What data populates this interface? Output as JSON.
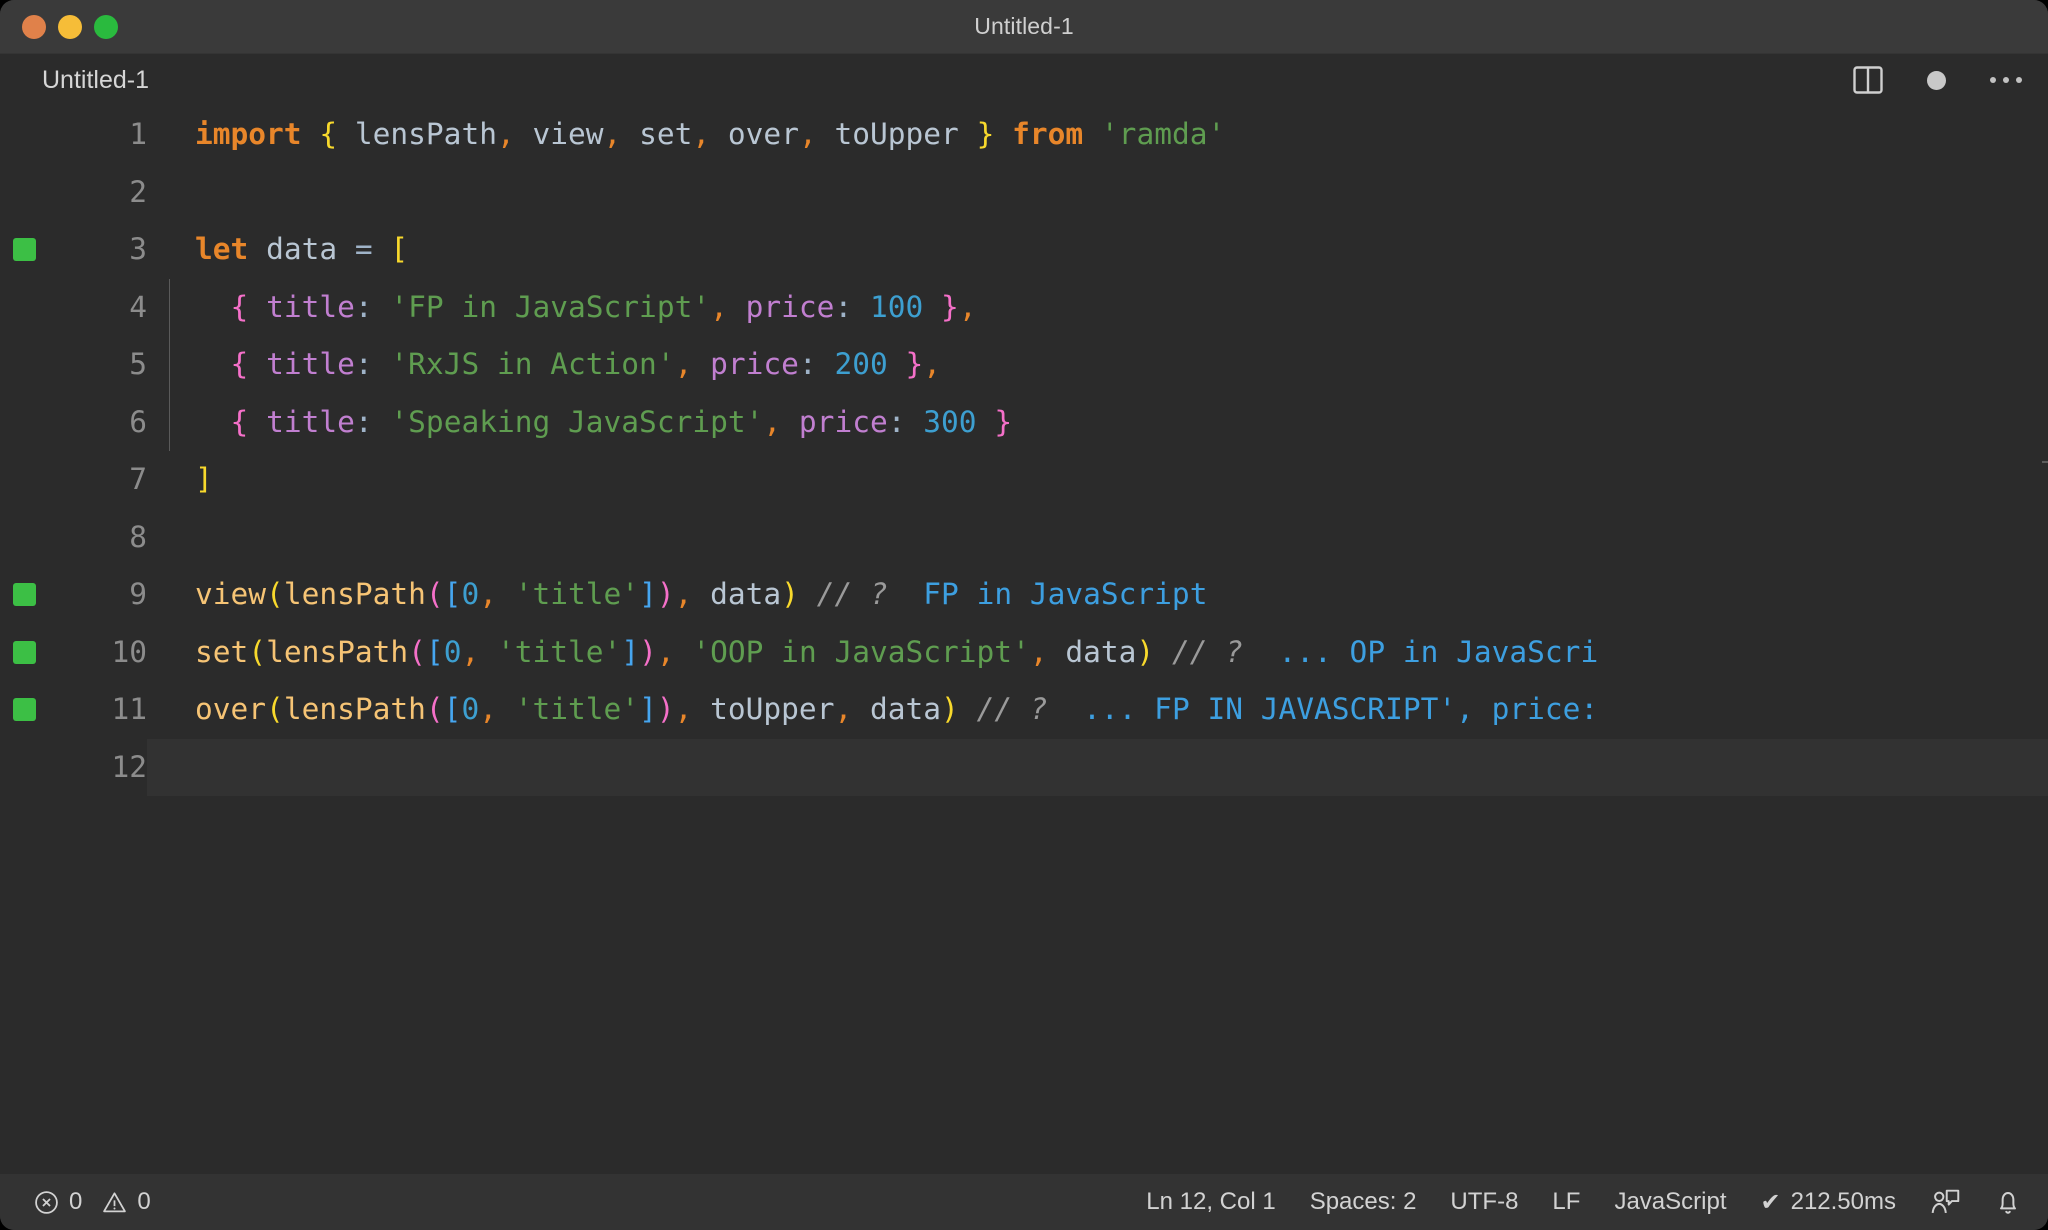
{
  "window": {
    "title": "Untitled-1",
    "traffic_lights": [
      {
        "name": "close",
        "color": "#e0814a"
      },
      {
        "name": "minimize",
        "color": "#f6bd38"
      },
      {
        "name": "maximize",
        "color": "#2aba3e"
      }
    ]
  },
  "tabbar": {
    "tab_label": "Untitled-1",
    "actions": [
      {
        "icon": "split-editor-icon"
      },
      {
        "icon": "unsaved-dot-icon"
      },
      {
        "icon": "more-actions-icon"
      }
    ]
  },
  "editor": {
    "language": "JavaScript",
    "current_line": 12,
    "lines": [
      {
        "n": "1",
        "mark": false,
        "indent": false,
        "current": false,
        "tokens": [
          {
            "t": "import",
            "c": "kw"
          },
          {
            "t": " ",
            "c": "id"
          },
          {
            "t": "{",
            "c": "punc-y"
          },
          {
            "t": " ",
            "c": "id"
          },
          {
            "t": "lensPath",
            "c": "id"
          },
          {
            "t": ",",
            "c": "comma"
          },
          {
            "t": " ",
            "c": "id"
          },
          {
            "t": "view",
            "c": "id"
          },
          {
            "t": ",",
            "c": "comma"
          },
          {
            "t": " ",
            "c": "id"
          },
          {
            "t": "set",
            "c": "id"
          },
          {
            "t": ",",
            "c": "comma"
          },
          {
            "t": " ",
            "c": "id"
          },
          {
            "t": "over",
            "c": "id"
          },
          {
            "t": ",",
            "c": "comma"
          },
          {
            "t": " ",
            "c": "id"
          },
          {
            "t": "toUpper",
            "c": "id"
          },
          {
            "t": " ",
            "c": "id"
          },
          {
            "t": "}",
            "c": "punc-y"
          },
          {
            "t": " ",
            "c": "id"
          },
          {
            "t": "from",
            "c": "kw"
          },
          {
            "t": " ",
            "c": "id"
          },
          {
            "t": "'ramda'",
            "c": "str"
          }
        ]
      },
      {
        "n": "2",
        "mark": false,
        "indent": false,
        "current": false,
        "tokens": []
      },
      {
        "n": "3",
        "mark": true,
        "indent": false,
        "current": false,
        "tokens": [
          {
            "t": "let",
            "c": "kw"
          },
          {
            "t": " ",
            "c": "id"
          },
          {
            "t": "data",
            "c": "id"
          },
          {
            "t": " ",
            "c": "id"
          },
          {
            "t": "=",
            "c": "colon"
          },
          {
            "t": " ",
            "c": "id"
          },
          {
            "t": "[",
            "c": "punc-y"
          }
        ]
      },
      {
        "n": "4",
        "mark": false,
        "indent": true,
        "current": false,
        "tokens": [
          {
            "t": "  ",
            "c": "id"
          },
          {
            "t": "{",
            "c": "punc-p"
          },
          {
            "t": " ",
            "c": "id"
          },
          {
            "t": "title",
            "c": "prop"
          },
          {
            "t": ":",
            "c": "colon"
          },
          {
            "t": " ",
            "c": "id"
          },
          {
            "t": "'FP in JavaScript'",
            "c": "str"
          },
          {
            "t": ",",
            "c": "comma"
          },
          {
            "t": " ",
            "c": "id"
          },
          {
            "t": "price",
            "c": "prop"
          },
          {
            "t": ":",
            "c": "colon"
          },
          {
            "t": " ",
            "c": "id"
          },
          {
            "t": "100",
            "c": "num"
          },
          {
            "t": " ",
            "c": "id"
          },
          {
            "t": "}",
            "c": "punc-p"
          },
          {
            "t": ",",
            "c": "comma"
          }
        ]
      },
      {
        "n": "5",
        "mark": false,
        "indent": true,
        "current": false,
        "tokens": [
          {
            "t": "  ",
            "c": "id"
          },
          {
            "t": "{",
            "c": "punc-p"
          },
          {
            "t": " ",
            "c": "id"
          },
          {
            "t": "title",
            "c": "prop"
          },
          {
            "t": ":",
            "c": "colon"
          },
          {
            "t": " ",
            "c": "id"
          },
          {
            "t": "'RxJS in Action'",
            "c": "str"
          },
          {
            "t": ",",
            "c": "comma"
          },
          {
            "t": " ",
            "c": "id"
          },
          {
            "t": "price",
            "c": "prop"
          },
          {
            "t": ":",
            "c": "colon"
          },
          {
            "t": " ",
            "c": "id"
          },
          {
            "t": "200",
            "c": "num"
          },
          {
            "t": " ",
            "c": "id"
          },
          {
            "t": "}",
            "c": "punc-p"
          },
          {
            "t": ",",
            "c": "comma"
          }
        ]
      },
      {
        "n": "6",
        "mark": false,
        "indent": true,
        "current": false,
        "tokens": [
          {
            "t": "  ",
            "c": "id"
          },
          {
            "t": "{",
            "c": "punc-p"
          },
          {
            "t": " ",
            "c": "id"
          },
          {
            "t": "title",
            "c": "prop"
          },
          {
            "t": ":",
            "c": "colon"
          },
          {
            "t": " ",
            "c": "id"
          },
          {
            "t": "'Speaking JavaScript'",
            "c": "str"
          },
          {
            "t": ",",
            "c": "comma"
          },
          {
            "t": " ",
            "c": "id"
          },
          {
            "t": "price",
            "c": "prop"
          },
          {
            "t": ":",
            "c": "colon"
          },
          {
            "t": " ",
            "c": "id"
          },
          {
            "t": "300",
            "c": "num"
          },
          {
            "t": " ",
            "c": "id"
          },
          {
            "t": "}",
            "c": "punc-p"
          }
        ]
      },
      {
        "n": "7",
        "mark": false,
        "indent": false,
        "current": false,
        "tokens": [
          {
            "t": "]",
            "c": "punc-y"
          }
        ]
      },
      {
        "n": "8",
        "mark": false,
        "indent": false,
        "current": false,
        "tokens": []
      },
      {
        "n": "9",
        "mark": true,
        "indent": false,
        "current": false,
        "tokens": [
          {
            "t": "view",
            "c": "fn"
          },
          {
            "t": "(",
            "c": "punc-y"
          },
          {
            "t": "lensPath",
            "c": "fn"
          },
          {
            "t": "(",
            "c": "punc-p"
          },
          {
            "t": "[",
            "c": "punc-b"
          },
          {
            "t": "0",
            "c": "num"
          },
          {
            "t": ",",
            "c": "comma"
          },
          {
            "t": " ",
            "c": "id"
          },
          {
            "t": "'title'",
            "c": "str"
          },
          {
            "t": "]",
            "c": "punc-b"
          },
          {
            "t": ")",
            "c": "punc-p"
          },
          {
            "t": ",",
            "c": "comma"
          },
          {
            "t": " ",
            "c": "id"
          },
          {
            "t": "data",
            "c": "id"
          },
          {
            "t": ")",
            "c": "punc-y"
          },
          {
            "t": " ",
            "c": "id"
          },
          {
            "t": "// ?",
            "c": "cmt"
          },
          {
            "t": "  ",
            "c": "id"
          },
          {
            "t": "FP in JavaScript",
            "c": "res"
          }
        ]
      },
      {
        "n": "10",
        "mark": true,
        "indent": false,
        "current": false,
        "tokens": [
          {
            "t": "set",
            "c": "fn"
          },
          {
            "t": "(",
            "c": "punc-y"
          },
          {
            "t": "lensPath",
            "c": "fn"
          },
          {
            "t": "(",
            "c": "punc-p"
          },
          {
            "t": "[",
            "c": "punc-b"
          },
          {
            "t": "0",
            "c": "num"
          },
          {
            "t": ",",
            "c": "comma"
          },
          {
            "t": " ",
            "c": "id"
          },
          {
            "t": "'title'",
            "c": "str"
          },
          {
            "t": "]",
            "c": "punc-b"
          },
          {
            "t": ")",
            "c": "punc-p"
          },
          {
            "t": ",",
            "c": "comma"
          },
          {
            "t": " ",
            "c": "id"
          },
          {
            "t": "'OOP in JavaScript'",
            "c": "str"
          },
          {
            "t": ",",
            "c": "comma"
          },
          {
            "t": " ",
            "c": "id"
          },
          {
            "t": "data",
            "c": "id"
          },
          {
            "t": ")",
            "c": "punc-y"
          },
          {
            "t": " ",
            "c": "id"
          },
          {
            "t": "// ?",
            "c": "cmt"
          },
          {
            "t": "  ",
            "c": "id"
          },
          {
            "t": "... OP in JavaScri",
            "c": "res"
          }
        ]
      },
      {
        "n": "11",
        "mark": true,
        "indent": false,
        "current": false,
        "tokens": [
          {
            "t": "over",
            "c": "fn"
          },
          {
            "t": "(",
            "c": "punc-y"
          },
          {
            "t": "lensPath",
            "c": "fn"
          },
          {
            "t": "(",
            "c": "punc-p"
          },
          {
            "t": "[",
            "c": "punc-b"
          },
          {
            "t": "0",
            "c": "num"
          },
          {
            "t": ",",
            "c": "comma"
          },
          {
            "t": " ",
            "c": "id"
          },
          {
            "t": "'title'",
            "c": "str"
          },
          {
            "t": "]",
            "c": "punc-b"
          },
          {
            "t": ")",
            "c": "punc-p"
          },
          {
            "t": ",",
            "c": "comma"
          },
          {
            "t": " ",
            "c": "id"
          },
          {
            "t": "toUpper",
            "c": "id"
          },
          {
            "t": ",",
            "c": "comma"
          },
          {
            "t": " ",
            "c": "id"
          },
          {
            "t": "data",
            "c": "id"
          },
          {
            "t": ")",
            "c": "punc-y"
          },
          {
            "t": " ",
            "c": "id"
          },
          {
            "t": "// ?",
            "c": "cmt"
          },
          {
            "t": "  ",
            "c": "id"
          },
          {
            "t": "... FP IN JAVASCRIPT', price:",
            "c": "res"
          }
        ]
      },
      {
        "n": "12",
        "mark": false,
        "indent": false,
        "current": true,
        "tokens": []
      }
    ]
  },
  "statusbar": {
    "errors": "0",
    "warnings": "0",
    "cursor": "Ln 12, Col 1",
    "indentation": "Spaces: 2",
    "encoding": "UTF-8",
    "eol": "LF",
    "language": "JavaScript",
    "runtime": "212.50ms",
    "runtime_prefix": "✔",
    "icons": [
      "error-icon",
      "warning-icon",
      "feedback-icon",
      "bell-icon"
    ]
  },
  "colors": {
    "editor_background": "#2b2b2b",
    "titlebar_background": "#3a3a3a",
    "statusbar_background": "#333333",
    "gutter_mark": "#3cbf45",
    "keyword": "#e8862a",
    "string": "#5f9d50",
    "number": "#3d9fd0",
    "function": "#f6c475",
    "property": "#c17fd0",
    "comment": "#9a9a9a",
    "inline_result": "#3d9fe0",
    "bracket_yellow": "#f8d92c",
    "bracket_pink": "#f570c9",
    "bracket_blue": "#46a6f0"
  }
}
